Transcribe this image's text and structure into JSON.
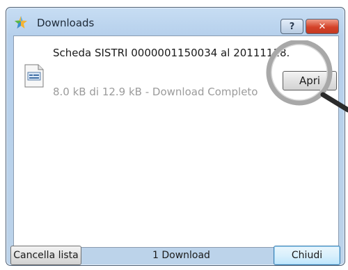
{
  "window": {
    "title": "Downloads",
    "help_label": "?",
    "close_label": "✕"
  },
  "download_item": {
    "file_name": "Scheda SISTRI 0000001150034 al 20111118.",
    "status": "8.0 kB di 12.9 kB - Download Completo",
    "open_label": "Apri"
  },
  "footer": {
    "clear_label": "Cancella lista",
    "count_text": "1 Download",
    "close_label": "Chiudi"
  },
  "icons": {
    "app": "downloads-star-icon",
    "file": "document-icon",
    "help": "question-mark-icon",
    "close": "close-x-icon",
    "overlay": "magnifier-overlay"
  },
  "colors": {
    "close_button": "#d44329",
    "status_text": "#9b9b9b",
    "titlebar": "#c7ddf3"
  }
}
